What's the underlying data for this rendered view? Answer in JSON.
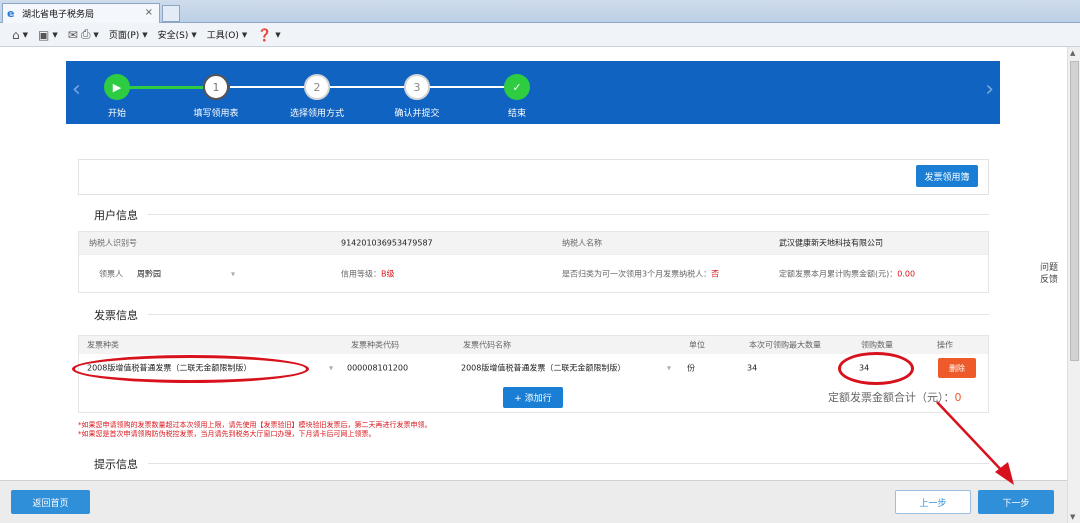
{
  "browser": {
    "tab_title": "湖北省电子税务局",
    "tab_close": "×",
    "menu": {
      "page": "页面(P)",
      "safety": "安全(S)",
      "tools": "工具(O)"
    }
  },
  "wizard": {
    "steps": [
      {
        "label": "开始",
        "marker": "▶"
      },
      {
        "label": "填写领用表",
        "marker": "1"
      },
      {
        "label": "选择领用方式",
        "marker": "2"
      },
      {
        "label": "确认并提交",
        "marker": "3"
      },
      {
        "label": "结束",
        "marker": "✓"
      }
    ]
  },
  "actions": {
    "invoice_book_btn": "发票领用簿"
  },
  "user_info": {
    "section_title": "用户信息",
    "taxpayer_id_label": "纳税人识别号",
    "taxpayer_id": "914201036953479587",
    "taxpayer_name_label": "纳税人名称",
    "taxpayer_name": "武汉健康新天地科技有限公司",
    "receiver_label": "领票人",
    "receiver": "周黔园",
    "credit_label": "信用等级：",
    "credit_value": "B级",
    "three_month_label": "是否归类为可一次领用3个月发票纳税人：",
    "three_month_value": "否",
    "quota_label": "定额发票本月累计购票金额(元)：",
    "quota_value": "0.00"
  },
  "invoice_info": {
    "section_title": "发票信息",
    "columns": [
      "发票种类",
      "发票种类代码",
      "发票代码名称",
      "单位",
      "本次可领购最大数量",
      "领购数量",
      "操作"
    ],
    "row": {
      "type": "2008版增值税普通发票（二联无金额限制版）",
      "type_code": "000008101200",
      "code_name": "2008版增值税普通发票（二联无金额限制版）",
      "unit": "份",
      "max_qty": "34",
      "qty": "34",
      "delete": "删除"
    },
    "add_row": "+ 添加行",
    "total_label": "定额发票金额合计（元）：",
    "total_value": "0"
  },
  "notes": [
    "*如果您申请领购的发票数量超过本次领用上限，请先使用【发票验旧】模块验旧发票后，第二天再进行发票申领。",
    "*如果您是首次申请领购防伪税控发票，当月请先到税务大厅窗口办理，下月请卡后可网上领票。"
  ],
  "tips": {
    "section_title": "提示信息"
  },
  "side_help": {
    "line1": "问题",
    "line2": "反馈"
  },
  "footer": {
    "home": "返回首页",
    "prev": "上一步",
    "next": "下一步"
  },
  "colors": {
    "banner": "#1063c0",
    "step_done": "#2ecc40",
    "primary_button": "#2f8fd8",
    "delete_button": "#ef5a2a",
    "annotation": "#d8121c"
  }
}
